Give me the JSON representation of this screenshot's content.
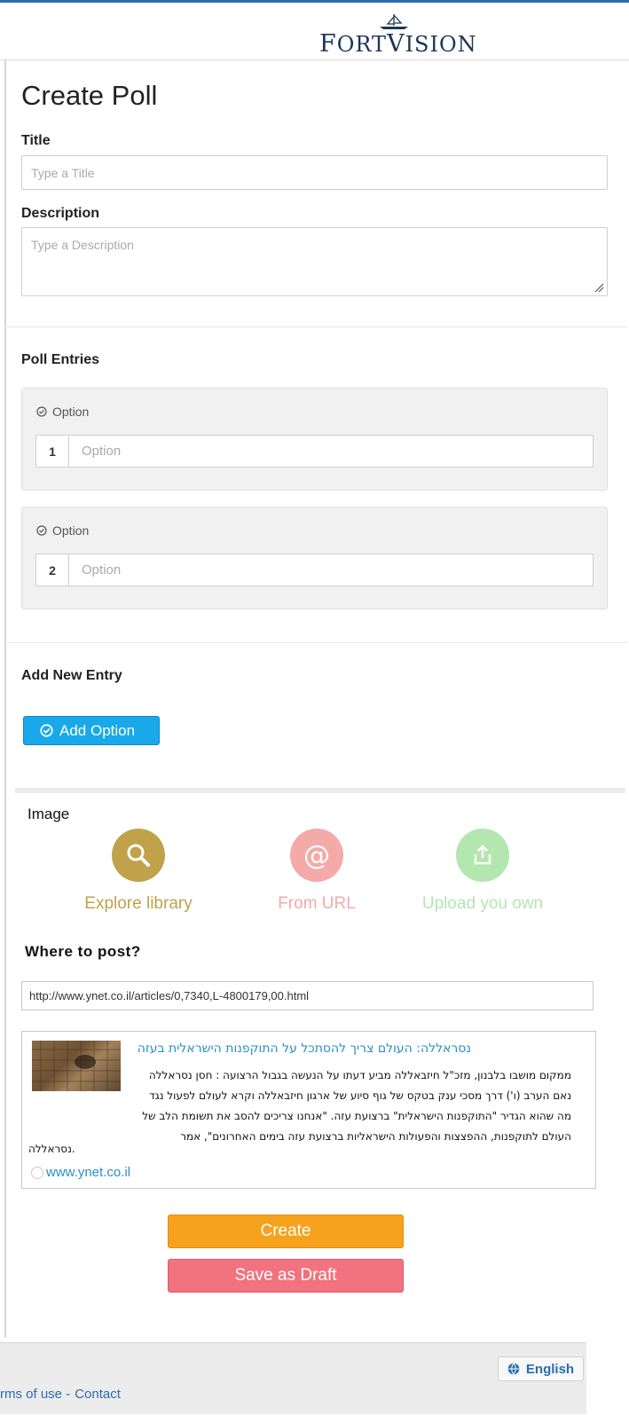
{
  "header": {
    "logo_text_1": "F",
    "logo_text_2": "ORT",
    "logo_text_3": "V",
    "logo_text_4": "ISION"
  },
  "form": {
    "heading": "Create Poll",
    "title_label": "Title",
    "title_placeholder": "Type a Title",
    "description_label": "Description",
    "description_placeholder": "Type a Description"
  },
  "poll_entries": {
    "heading": "Poll Entries",
    "entries": [
      {
        "label": "Option",
        "number": "1",
        "placeholder": "Option"
      },
      {
        "label": "Option",
        "number": "2",
        "placeholder": "Option"
      }
    ]
  },
  "add_entry": {
    "heading": "Add New Entry",
    "button_label": "Add Option"
  },
  "image": {
    "label": "Image",
    "options": [
      {
        "caption": "Explore library",
        "icon": "search-icon",
        "color": "#bfa24a"
      },
      {
        "caption": "From URL",
        "icon": "at-sign-icon",
        "color": "#f3aaa8"
      },
      {
        "caption": "Upload you own",
        "icon": "upload-icon",
        "color": "#b4e6b0"
      }
    ]
  },
  "post": {
    "heading": "Where to post?",
    "url": "http://www.ynet.co.il/articles/0,7340,L-4800179,00.html",
    "preview_title": "נסראללה: העולם צריך להסתכל על התוקפנות הישראלית בעזה",
    "preview_body": "ממקום מושבו בלבנון, מזכ\"ל חיזבאללה מביע דעתו על הנעשה בגבול הרצועה : חסן נסראללה נאם הערב (ו') דרך מסכי ענק בטקס של גוף סיוע של ארגון חיזבאללה וקרא לעולם לפעול נגד מה שהוא הגדיר \"התוקפנות הישראלית\" ברצועת עזה. \"אנחנו צריכים להסב את תשומת הלב של העולם לתוקפנות, ההפצצות והפעולות הישראליות ברצועת עזה בימים האחרונים\", אמר",
    "preview_tail": "נסראללה.",
    "site": "www.ynet.co.il"
  },
  "actions": {
    "create": "Create",
    "draft": "Save as Draft"
  },
  "footer": {
    "links": [
      "rms of use -",
      "Contact"
    ],
    "language": "English"
  },
  "colors": {
    "accent": "#2b6cb0",
    "create": "#f7a21d",
    "draft": "#f2727f",
    "add": "#19a9ea"
  }
}
